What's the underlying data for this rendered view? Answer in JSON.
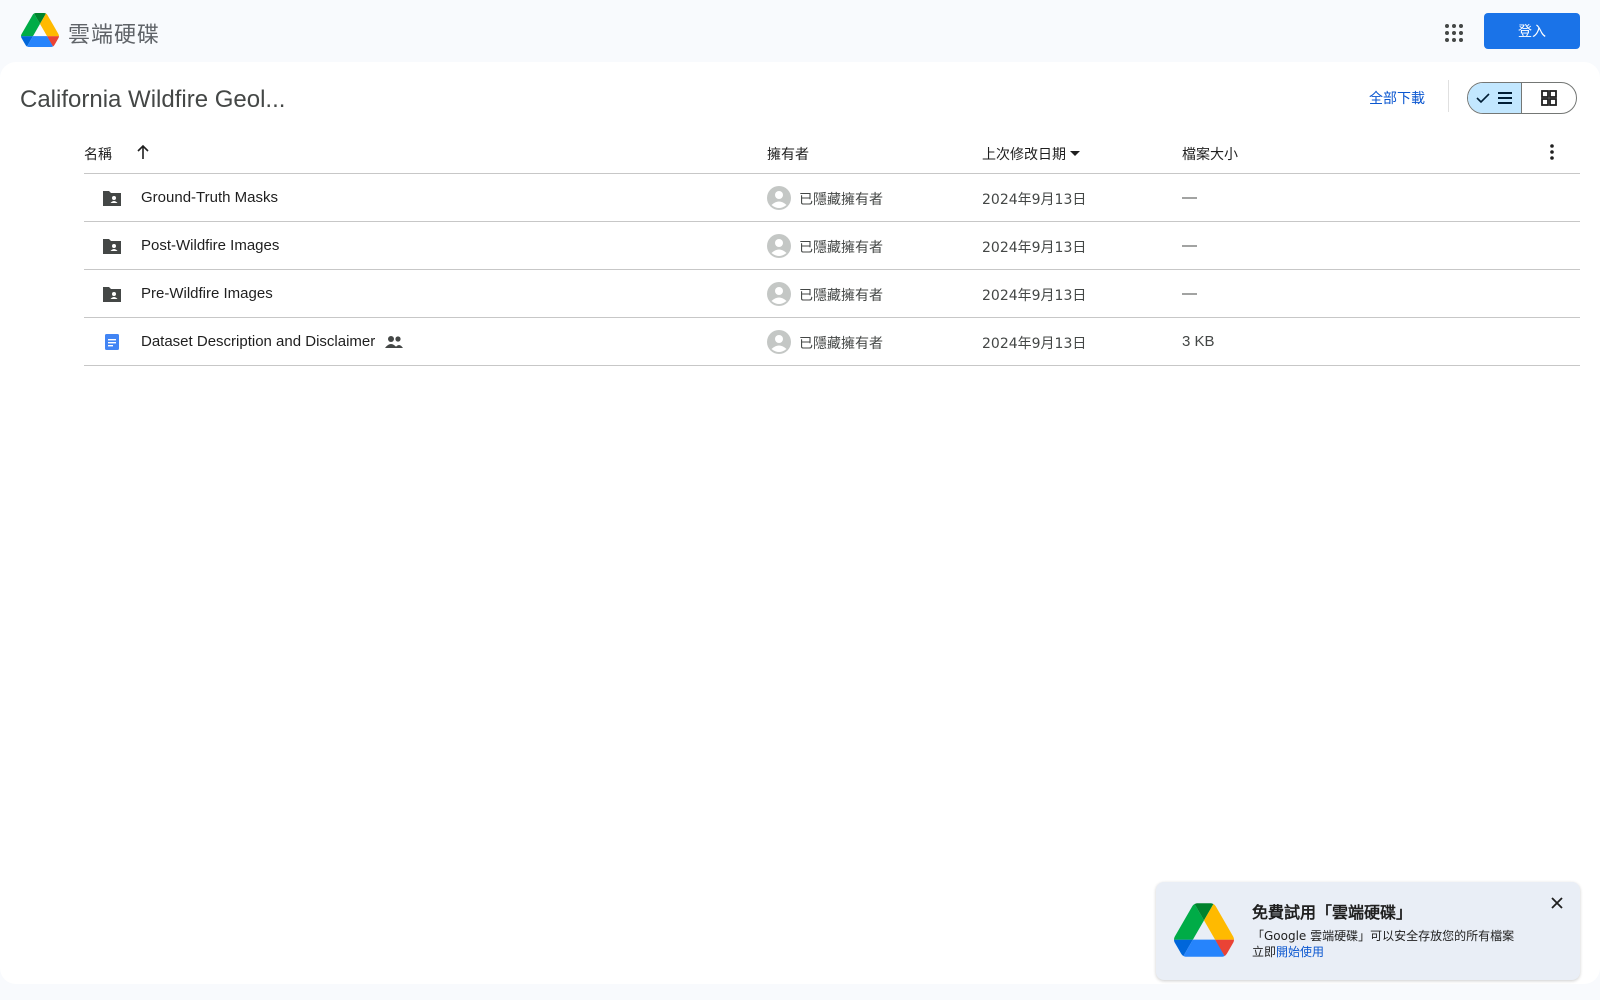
{
  "header": {
    "app_name": "雲端硬碟",
    "signin_label": "登入",
    "apps_icon": "apps-grid-icon"
  },
  "folder": {
    "title": "California Wildfire Geol...",
    "download_all_label": "全部下載",
    "view_modes": [
      "list",
      "grid"
    ],
    "active_view": "list"
  },
  "table": {
    "columns": {
      "name": "名稱",
      "owner": "擁有者",
      "modified": "上次修改日期",
      "size": "檔案大小"
    },
    "sort": {
      "name_direction": "ascending",
      "modified_direction": "descending"
    },
    "rows": [
      {
        "name": "Ground-Truth Masks",
        "type": "shared-folder",
        "icon": "shared-folder-icon",
        "owner": "已隱藏擁有者",
        "modified": "2024年9月13日",
        "size": "—",
        "shared": false
      },
      {
        "name": "Post-Wildfire Images",
        "type": "shared-folder",
        "icon": "shared-folder-icon",
        "owner": "已隱藏擁有者",
        "modified": "2024年9月13日",
        "size": "—",
        "shared": false
      },
      {
        "name": "Pre-Wildfire Images",
        "type": "shared-folder",
        "icon": "shared-folder-icon",
        "owner": "已隱藏擁有者",
        "modified": "2024年9月13日",
        "size": "—",
        "shared": false
      },
      {
        "name": "Dataset Description and Disclaimer",
        "type": "document",
        "icon": "google-docs-icon",
        "owner": "已隱藏擁有者",
        "modified": "2024年9月13日",
        "size": "3 KB",
        "shared": true
      }
    ]
  },
  "promo": {
    "title": "免費試用「雲端硬碟」",
    "body": "「Google 雲端硬碟」可以安全存放您的所有檔案",
    "cta_prefix": "立即",
    "cta_link": "開始使用"
  },
  "colors": {
    "accent": "#1a73e8",
    "link": "#0b57d0",
    "toggle_active": "#c2e7ff",
    "background": "#f8fafd",
    "doc_blue": "#4285f4"
  }
}
